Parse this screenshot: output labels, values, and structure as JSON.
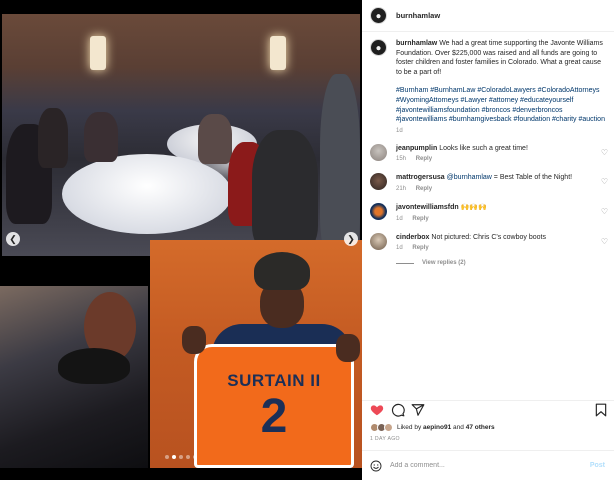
{
  "post": {
    "username": "burnhamlaw",
    "caption": "We had a great time supporting the Javonte Williams Foundation. Over $225,000 was raised and all funds are going to foster children and foster families in Colorado. What a great cause to be a part of!",
    "hashtags": "#Burnham #BurnhamLaw #ColoradoLawyers #ColoradoAttorneys #WyomingAttorneys #Lawyer #attorney #educateyourself #javontewilliamsfoundation #broncos #denverbroncos #javontewilliams #burnhamgivesback #foundation #charity #auction",
    "age": "1d"
  },
  "photo": {
    "jersey_name": "SURTAIN II",
    "jersey_number": "2",
    "carousel": {
      "total": 5,
      "active": 1
    }
  },
  "comments": [
    {
      "username": "jeanpumplin",
      "text": "Looks like such a great time!",
      "mention": "",
      "age": "15h",
      "reply_label": "Reply"
    },
    {
      "username": "mattrogersusa",
      "text": "= Best Table of the Night!",
      "mention": "@burnhamlaw",
      "age": "21h",
      "reply_label": "Reply"
    },
    {
      "username": "javontewilliamsfdn",
      "text": "🙌🙌🙌",
      "mention": "",
      "age": "1d",
      "reply_label": "Reply"
    },
    {
      "username": "cinderbox",
      "text": "Not pictured: Chris C's cowboy boots",
      "mention": "",
      "age": "1d",
      "reply_label": "Reply"
    }
  ],
  "view_replies": "View replies (2)",
  "likes": {
    "prefix": "Liked by",
    "user": "aepino91",
    "connector": "and",
    "count": "47 others"
  },
  "date": "1 DAY AGO",
  "composer": {
    "placeholder": "Add a comment...",
    "post_label": "Post"
  },
  "colors": {
    "like_red": "#ed4956",
    "link_blue": "#00376b",
    "post_disabled": "#b2dffc",
    "jersey_orange": "#f26a1b",
    "jersey_navy": "#1b2f57"
  },
  "icons": [
    "heart-icon",
    "comment-icon",
    "share-icon",
    "bookmark-icon",
    "smile-icon",
    "chevron-left-icon",
    "chevron-right-icon"
  ]
}
